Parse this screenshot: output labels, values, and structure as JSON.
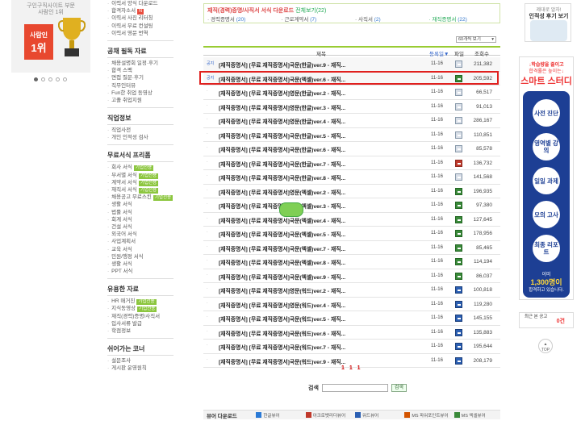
{
  "banner": {
    "top_text": "구인구직사이트 부문",
    "top_text2": "사람인 1위",
    "badge_brand": "사람인",
    "badge_rank": "1위"
  },
  "sidebar": {
    "group1": [
      "이력서 양식 다운로드",
      "합격자소서",
      "이력서 사진 리터칭",
      "이력서 무료 컨설팅",
      "이력서 영문 번역"
    ],
    "group1_new_tag": "N",
    "sec2_title": "공채 필독 자료",
    "group2": [
      "채용설명회 일정·후기",
      "합격 스펙",
      "면접 질문·후기",
      "직무인터뷰",
      "Fun한 취업 동영상",
      "고졸 취업지원"
    ],
    "sec3_title": "직업정보",
    "group3": [
      "직업사전",
      "개인 인적성 검사"
    ],
    "sec4_title": "무료서식 프리폼",
    "group4": [
      {
        "label": "회사 서식",
        "tag": "기업전용"
      },
      {
        "label": "부서별 서식",
        "tag": "기업전용"
      },
      {
        "label": "계약서 서식",
        "tag": "기업전용"
      },
      {
        "label": "재직서 서식",
        "tag": "기업전용"
      },
      {
        "label": "채용공고 무료스킨",
        "tag": "기업전용"
      },
      {
        "label": "생활 서식",
        "tag": ""
      },
      {
        "label": "법률 서식",
        "tag": ""
      },
      {
        "label": "회계 서식",
        "tag": ""
      },
      {
        "label": "건설 서식",
        "tag": ""
      },
      {
        "label": "외국어 서식",
        "tag": ""
      },
      {
        "label": "사업계획서",
        "tag": ""
      },
      {
        "label": "교육 서식",
        "tag": ""
      },
      {
        "label": "민원/행정 서식",
        "tag": ""
      },
      {
        "label": "생활 서식",
        "tag": ""
      },
      {
        "label": "PPT 서식",
        "tag": ""
      }
    ],
    "sec5_title": "유용한 자료",
    "group5": [
      {
        "label": "HR 매거진",
        "tag": "기업전용"
      },
      {
        "label": "지식동영상",
        "tag": "기업전용"
      },
      {
        "label": "재직(경력)증명/사직서",
        "tag": ""
      },
      {
        "label": "입사서류 발급",
        "tag": ""
      },
      {
        "label": "학점정보",
        "tag": ""
      }
    ],
    "sec6_title": "쉬어가는 코너",
    "group6": [
      "설문조사",
      "게시판 운영원칙"
    ]
  },
  "categories": {
    "heading": "재직(경력)증명/사직서 서식 다운로드",
    "all_label": "전체보기(22)",
    "items": [
      {
        "label": "경력증명서",
        "count": "(20)"
      },
      {
        "label": "근로계약서",
        "count": "(7)"
      },
      {
        "label": "사직서",
        "count": "(2)"
      },
      {
        "label": "재직증명서",
        "count": "(22)"
      }
    ]
  },
  "per_page": "60개씩 보기",
  "table": {
    "col_title": "제목",
    "col_date": "등록일▼",
    "col_file": "파일",
    "col_views": "조회수",
    "rows": [
      {
        "num": "공지",
        "title": "[재직증명서] [무료 재직증명서]국문(한글)ver.9 - 재직...",
        "date": "11-16",
        "ftype": "hwp",
        "views": "211,382"
      },
      {
        "num": "공지",
        "title": "[재직증명서] [무료 재직증명서]국문(엑셀)ver.6 - 재직...",
        "date": "11-16",
        "ftype": "xls",
        "views": "205,592"
      },
      {
        "num": "·",
        "title": "[재직증명서] [무료 재직증명서]영문(한글)ver.2 - 재직...",
        "date": "11-16",
        "ftype": "hwp",
        "views": "66,517"
      },
      {
        "num": "·",
        "title": "[재직증명서] [무료 재직증명서]영문(한글)ver.3 - 재직...",
        "date": "11-16",
        "ftype": "hwp",
        "views": "91,013"
      },
      {
        "num": "·",
        "title": "[재직증명서] [무료 재직증명서]영문(한글)ver.4 - 재직...",
        "date": "11-16",
        "ftype": "hwp",
        "views": "286,167"
      },
      {
        "num": "·",
        "title": "[재직증명서] [무료 재직증명서]국문(한글)ver.5 - 재직...",
        "date": "11-16",
        "ftype": "hwp",
        "views": "110,851"
      },
      {
        "num": "·",
        "title": "[재직증명서] [무료 재직증명서]국문(한글)ver.6 - 재직...",
        "date": "11-16",
        "ftype": "hwp",
        "views": "85,578"
      },
      {
        "num": "·",
        "title": "[재직증명서] [무료 재직증명서]국문(한글)ver.7 - 재직...",
        "date": "11-16",
        "ftype": "pdf",
        "views": "136,732"
      },
      {
        "num": "·",
        "title": "[재직증명서] [무료 재직증명서]국문(한글)ver.8 - 재직...",
        "date": "11-16",
        "ftype": "hwp",
        "views": "141,568"
      },
      {
        "num": "·",
        "title": "[재직증명서] [무료 재직증명서]영문(엑셀)ver.2 - 재직...",
        "date": "11-16",
        "ftype": "xls",
        "views": "196,935"
      },
      {
        "num": "·",
        "title": "[재직증명서] [무료 재직증명서]영문(엑셀)ver.3 - 재직...",
        "date": "11-16",
        "ftype": "xls",
        "views": "97,380"
      },
      {
        "num": "·",
        "title": "[재직증명서] [무료 재직증명서]국문(엑셀)ver.4 - 재직...",
        "date": "11-16",
        "ftype": "xls",
        "views": "127,645"
      },
      {
        "num": "·",
        "title": "[재직증명서] [무료 재직증명서]국문(엑셀)ver.5 - 재직...",
        "date": "11-16",
        "ftype": "xls",
        "views": "178,956"
      },
      {
        "num": "·",
        "title": "[재직증명서] [무료 재직증명서]국문(엑셀)ver.7 - 재직...",
        "date": "11-16",
        "ftype": "xls",
        "views": "85,465"
      },
      {
        "num": "·",
        "title": "[재직증명서] [무료 재직증명서]국문(엑셀)ver.8 - 재직...",
        "date": "11-16",
        "ftype": "xls",
        "views": "114,194"
      },
      {
        "num": "·",
        "title": "[재직증명서] [무료 재직증명서]국문(엑셀)ver.9 - 재직...",
        "date": "11-16",
        "ftype": "xls",
        "views": "86,037"
      },
      {
        "num": "·",
        "title": "[재직증명서] [무료 재직증명서]영문(워드)ver.2 - 재직...",
        "date": "11-16",
        "ftype": "doc",
        "views": "100,818"
      },
      {
        "num": "·",
        "title": "[재직증명서] [무료 재직증명서]영문(워드)ver.4 - 재직...",
        "date": "11-16",
        "ftype": "doc",
        "views": "119,280"
      },
      {
        "num": "·",
        "title": "[재직증명서] [무료 재직증명서]국문(워드)ver.5 - 재직...",
        "date": "11-16",
        "ftype": "doc",
        "views": "145,155"
      },
      {
        "num": "·",
        "title": "[재직증명서] [무료 재직증명서]국문(워드)ver.6 - 재직...",
        "date": "11-16",
        "ftype": "doc",
        "views": "135,883"
      },
      {
        "num": "·",
        "title": "[재직증명서] [무료 재직증명서]국문(워드)ver.7 - 재직...",
        "date": "11-16",
        "ftype": "doc",
        "views": "195,644"
      },
      {
        "num": "·",
        "title": "[재직증명서] [무료 재직증명서]국문(워드)ver.9 - 재직...",
        "date": "11-16",
        "ftype": "doc",
        "views": "208,179"
      }
    ]
  },
  "pager": "1 1 1",
  "search": {
    "label": "검색",
    "button": "검색"
  },
  "viewers": {
    "title": "뷰어 다운로드",
    "items": [
      "한글뷰어",
      "아크로뱃리더뷰어",
      "워드뷰어",
      "MS 파워포인트뷰어",
      "MS 엑셀뷰어"
    ]
  },
  "right": {
    "box1_line1": "제대로 알자!",
    "box1_line2": "인적성 후기 보기",
    "box2_top1": "↓학습량을 줄이고",
    "box2_top2": "합격률은 높이는↓",
    "box2_brand": "스마트 스터디",
    "steps": [
      "사전 진단",
      "영역별 강의",
      "일일 과제",
      "모의 고사",
      "최종 리포트"
    ],
    "count_label": "이미",
    "count_value": "1,300명이",
    "count_sub": "합격하고 있습니다.",
    "recent_label": "최근 본 공고",
    "recent_count": "0건",
    "top_label": "TOP"
  },
  "colors": {
    "accent_green": "#99cc33",
    "highlight_red": "#e0201e",
    "side_blue": "#1d3f94"
  }
}
